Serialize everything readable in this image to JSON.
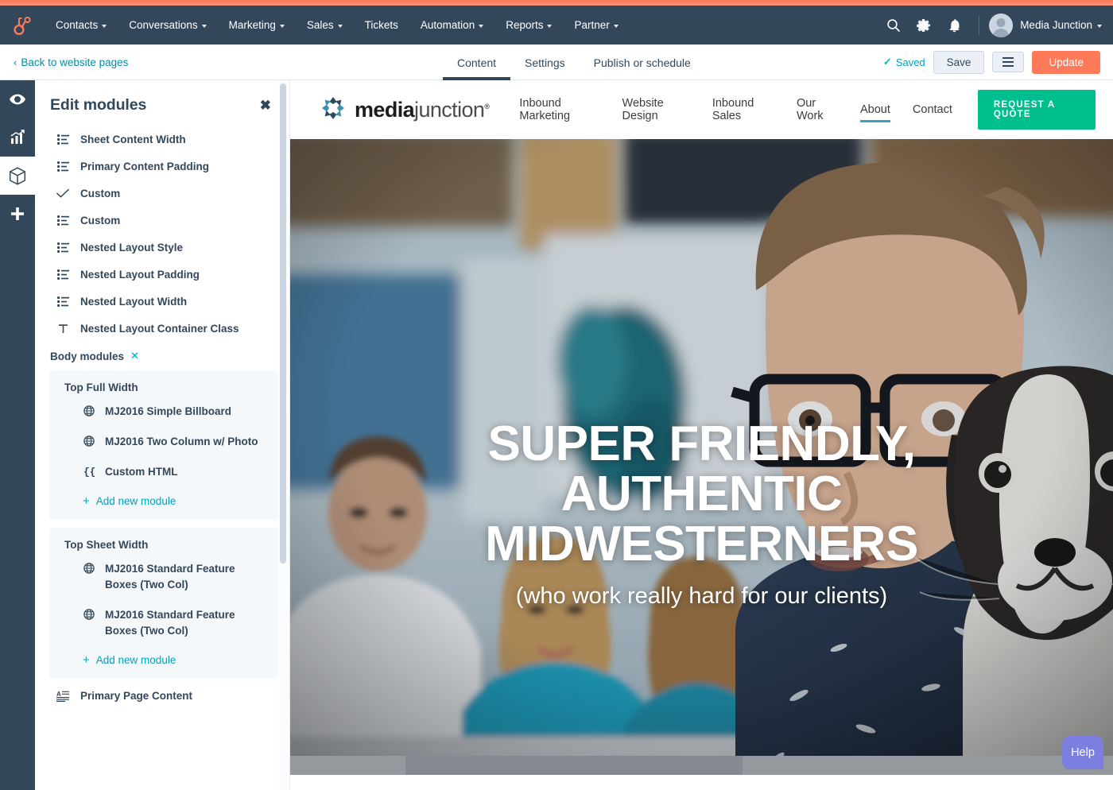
{
  "theme": {
    "coral": "#ff7a59",
    "navy": "#33475b",
    "teal": "#00a4bd",
    "green": "#00bf8f",
    "panel_bg": "#f5f8fa"
  },
  "hs_nav": {
    "logo_icon": "hubspot-sprocket-icon",
    "menu": [
      {
        "label": "Contacts",
        "has_caret": true
      },
      {
        "label": "Conversations",
        "has_caret": true
      },
      {
        "label": "Marketing",
        "has_caret": true
      },
      {
        "label": "Sales",
        "has_caret": true
      },
      {
        "label": "Tickets",
        "has_caret": false
      },
      {
        "label": "Automation",
        "has_caret": true
      },
      {
        "label": "Reports",
        "has_caret": true
      },
      {
        "label": "Partner",
        "has_caret": true
      }
    ],
    "icons": [
      "search-icon",
      "gear-icon",
      "bell-icon"
    ],
    "account_name": "Media Junction"
  },
  "editor_bar": {
    "back_label": "Back to website pages",
    "back_chevron": "‹",
    "tabs": [
      {
        "label": "Content",
        "active": true
      },
      {
        "label": "Settings",
        "active": false
      },
      {
        "label": "Publish or schedule",
        "active": false
      }
    ],
    "saved_label": "Saved",
    "saved_tick": "✓",
    "save_label": "Save",
    "menu_icon": "hamburger-icon",
    "update_label": "Update"
  },
  "rail": {
    "items": [
      {
        "icon": "eye-icon",
        "active": false
      },
      {
        "icon": "chart-icon",
        "active": false
      },
      {
        "icon": "box-icon",
        "active": true
      },
      {
        "icon": "plus-icon",
        "active": false
      }
    ]
  },
  "sidebar": {
    "title": "Edit modules",
    "close_icon": "✖",
    "modules": [
      {
        "label": "Sheet Content Width",
        "icon": "list-settings-icon"
      },
      {
        "label": "Primary Content Padding",
        "icon": "list-settings-icon"
      },
      {
        "label": "Custom",
        "icon": "check-icon"
      },
      {
        "label": "Custom",
        "icon": "list-settings-icon"
      },
      {
        "label": "Nested Layout Style",
        "icon": "list-settings-icon"
      },
      {
        "label": "Nested Layout Padding",
        "icon": "list-settings-icon"
      },
      {
        "label": "Nested Layout Width",
        "icon": "list-settings-icon"
      },
      {
        "label": "Nested Layout Container Class",
        "icon": "text-icon"
      }
    ],
    "body_modules_label": "Body modules",
    "body_modules_close": "✕",
    "groups": [
      {
        "title": "Top Full Width",
        "rows": [
          {
            "label": "MJ2016 Simple Billboard",
            "icon": "globe-icon"
          },
          {
            "label": "MJ2016 Two Column w/ Photo",
            "icon": "globe-icon"
          },
          {
            "label": "Custom HTML",
            "icon": "code-braces-icon"
          }
        ],
        "add_label": "Add new module"
      },
      {
        "title": "Top Sheet Width",
        "rows": [
          {
            "label": "MJ2016 Standard Feature Boxes (Two Col)",
            "icon": "globe-icon"
          },
          {
            "label": "MJ2016 Standard Feature Boxes (Two Col)",
            "icon": "globe-icon"
          }
        ],
        "add_label": "Add new module"
      }
    ],
    "footer_row": {
      "label": "Primary Page Content",
      "icon": "rich-text-icon"
    }
  },
  "preview": {
    "brand": {
      "mark_icon": "pinwheel-logo-icon",
      "bold": "media",
      "light": "junction",
      "reg": "®"
    },
    "nav": [
      {
        "label": "Inbound Marketing",
        "active": false
      },
      {
        "label": "Website Design",
        "active": false
      },
      {
        "label": "Inbound Sales",
        "active": false
      },
      {
        "label": "Our Work",
        "active": false
      },
      {
        "label": "About",
        "active": true
      },
      {
        "label": "Contact",
        "active": false
      }
    ],
    "cta_label": "REQUEST A QUOTE",
    "hero": {
      "line1": "SUPER FRIENDLY,",
      "line2": "AUTHENTIC",
      "line3": "MIDWESTERNERS",
      "subtitle": "(who work really hard for our clients)"
    },
    "help_label": "Help"
  }
}
